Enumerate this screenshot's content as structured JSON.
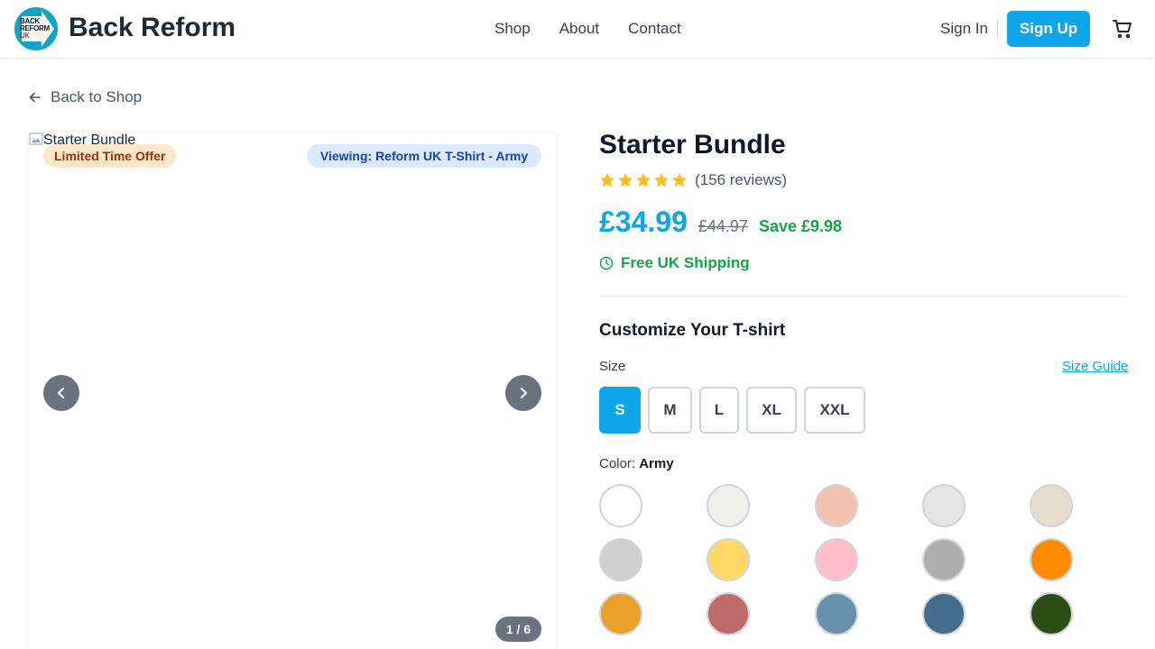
{
  "header": {
    "logo_text": [
      "BACK",
      "REFORM",
      "UK"
    ],
    "brand": "Back Reform",
    "nav": [
      "Shop",
      "About",
      "Contact"
    ],
    "sign_in": "Sign In",
    "sign_up": "Sign Up",
    "cart_icon": "cart-icon"
  },
  "back_link": "Back to Shop",
  "gallery": {
    "image_alt": "Starter Bundle",
    "offer_badge": "Limited Time Offer",
    "viewing_badge": "Viewing: Reform UK T-Shirt - Army",
    "counter": "1 / 6"
  },
  "product": {
    "title": "Starter Bundle",
    "rating": 5,
    "reviews": "(156 reviews)",
    "price": "£34.99",
    "old_price": "£44.97",
    "save": "Save £9.98",
    "shipping": "Free UK Shipping"
  },
  "customize": {
    "heading": "Customize Your T-shirt",
    "size_label": "Size",
    "size_guide": "Size Guide",
    "sizes": [
      "S",
      "M",
      "L",
      "XL",
      "XXL"
    ],
    "selected_size": "S",
    "color_label": "Color:",
    "selected_color": "Army",
    "colors": [
      "#ffffff",
      "#f0f0eb",
      "#f2c1b0",
      "#e5e5e5",
      "#e7dccd",
      "#d0d0d0",
      "#ffd866",
      "#ffbfc9",
      "#aeaeae",
      "#ff8c00",
      "#eba02a",
      "#c06b6b",
      "#6791ad",
      "#426e8c",
      "#2d4d16"
    ]
  }
}
